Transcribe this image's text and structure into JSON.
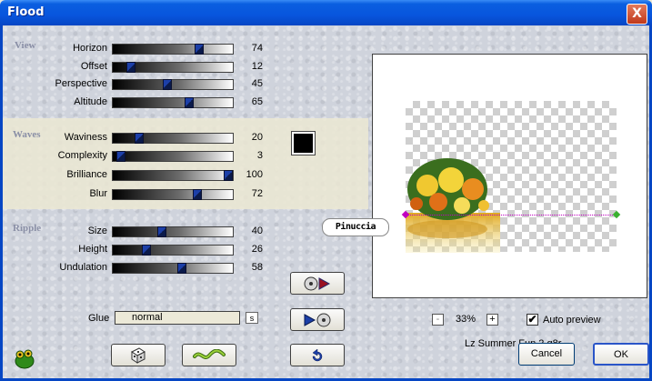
{
  "window": {
    "title": "Flood",
    "close_label": "X"
  },
  "groups": {
    "view": "View",
    "waves": "Waves",
    "ripple": "Ripple"
  },
  "params": [
    {
      "label": "Horizon",
      "value": "74"
    },
    {
      "label": "Offset",
      "value": "12"
    },
    {
      "label": "Perspective",
      "value": "45"
    },
    {
      "label": "Altitude",
      "value": "65"
    },
    {
      "label": "Waviness",
      "value": "20"
    },
    {
      "label": "Complexity",
      "value": "3"
    },
    {
      "label": "Brilliance",
      "value": "100"
    },
    {
      "label": "Blur",
      "value": "72"
    },
    {
      "label": "Size",
      "value": "40"
    },
    {
      "label": "Height",
      "value": "26"
    },
    {
      "label": "Undulation",
      "value": "58"
    }
  ],
  "color": {
    "swatch": "#000000"
  },
  "glue": {
    "label": "Glue",
    "value": "normal",
    "s_label": "s"
  },
  "preview": {
    "watermark": "Pinuccia",
    "preset_name": "Lz Summer Fun 2.q8r"
  },
  "zoom": {
    "minus": "-",
    "plus": "+",
    "level": "33%"
  },
  "auto_preview": {
    "label": "Auto preview",
    "checked": true,
    "mark": "✔"
  },
  "buttons": {
    "cancel": "Cancel",
    "ok": "OK"
  },
  "icons": {
    "logo": "frog-icon",
    "random": "dice-icon",
    "wave": "wave-icon",
    "load": "load-preset-icon",
    "save": "save-preset-icon",
    "reset": "undo-icon"
  },
  "colors": {
    "title_bar": "#0855dd",
    "accent": "#1c3fa8"
  }
}
